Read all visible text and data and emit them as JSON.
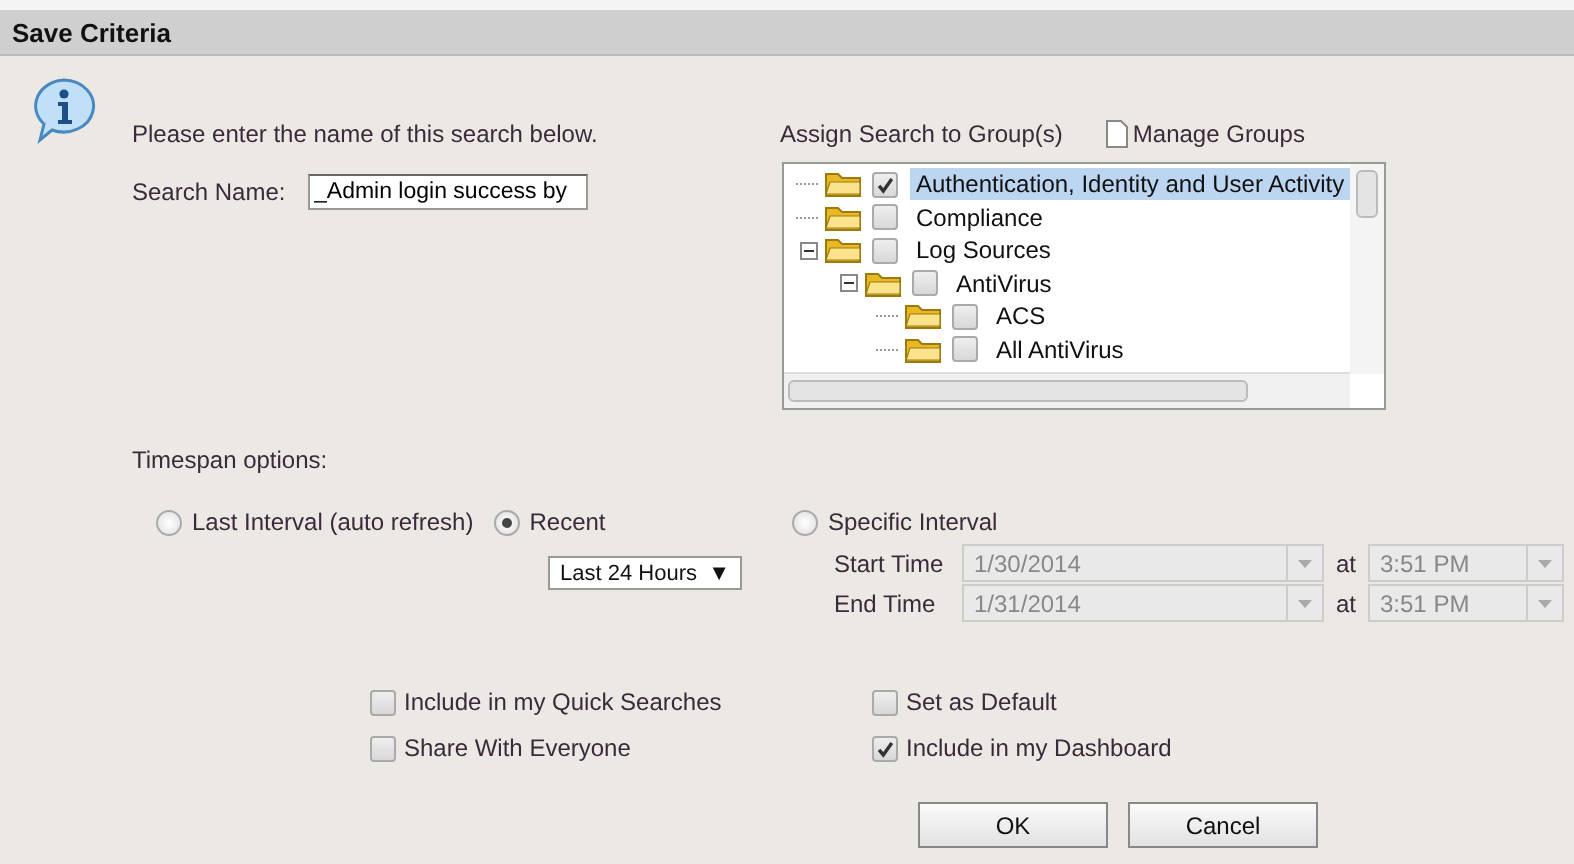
{
  "dialog": {
    "title": "Save Criteria"
  },
  "prompt": "Please enter the name of this search below.",
  "search_name": {
    "label": "Search Name:",
    "value": "_Admin login success by"
  },
  "groups": {
    "label": "Assign Search to Group(s)",
    "manage_link": "Manage Groups",
    "tree": [
      {
        "label": "Authentication, Identity and User Activity",
        "checked": true,
        "selected": true
      },
      {
        "label": "Compliance",
        "checked": false,
        "selected": false
      },
      {
        "label": "Log Sources",
        "checked": false,
        "selected": false,
        "expanded": true,
        "children": [
          {
            "label": "AntiVirus",
            "checked": false,
            "selected": false,
            "expanded": true,
            "children": [
              {
                "label": "ACS",
                "checked": false,
                "selected": false
              },
              {
                "label": "All AntiVirus",
                "checked": false,
                "selected": false
              }
            ]
          }
        ]
      }
    ]
  },
  "timespan": {
    "label": "Timespan options:",
    "options": [
      {
        "label": "Last Interval (auto refresh)",
        "selected": false
      },
      {
        "label": "Recent",
        "selected": true
      },
      {
        "label": "Specific Interval",
        "selected": false
      }
    ],
    "recent_select": {
      "value": "Last 24 Hours",
      "arrow": "▼"
    },
    "interval_rows": [
      {
        "label": "Start Time",
        "date": "1/30/2014",
        "at": "at",
        "time": "3:51 PM",
        "disabled": true
      },
      {
        "label": "End Time",
        "date": "1/31/2014",
        "at": "at",
        "time": "3:51 PM",
        "disabled": true
      }
    ]
  },
  "options_left": [
    {
      "label": "Include in my Quick Searches",
      "checked": false
    },
    {
      "label": "Share With Everyone",
      "checked": false
    }
  ],
  "options_right": [
    {
      "label": "Set as Default",
      "checked": false
    },
    {
      "label": "Include in my Dashboard",
      "checked": true
    }
  ],
  "buttons": [
    "OK",
    "Cancel"
  ]
}
